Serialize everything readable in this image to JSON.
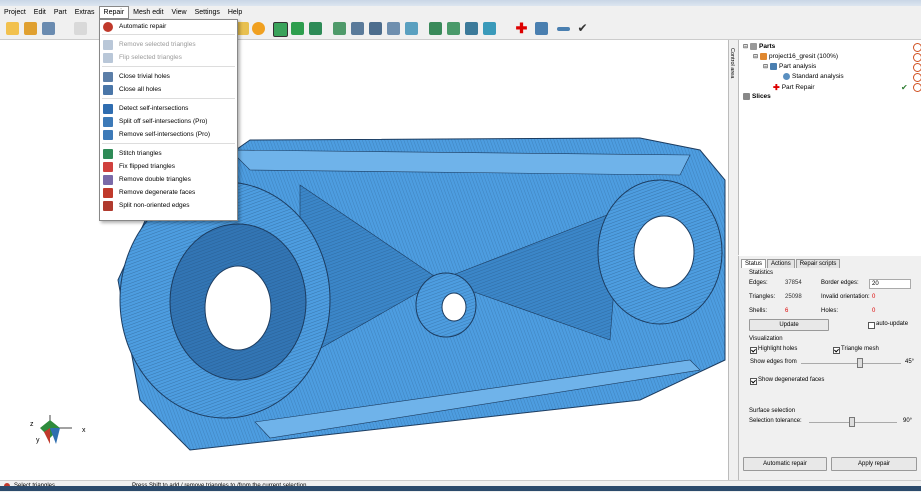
{
  "menu": [
    "Project",
    "Edit",
    "Part",
    "Extras",
    "Repair",
    "Mesh edit",
    "View",
    "Settings",
    "Help"
  ],
  "repair_menu": [
    {
      "label": "Automatic repair",
      "disabled": false,
      "icon": "auto-repair-icon",
      "color": "#c0392b"
    },
    {
      "label": "Remove selected triangles",
      "disabled": true,
      "icon": "remove-triangles-icon",
      "color": "#b9c7d8"
    },
    {
      "label": "Flip selected triangles",
      "disabled": true,
      "icon": "flip-triangles-icon",
      "color": "#b9c7d8"
    },
    {
      "label": "Close trivial holes",
      "disabled": false,
      "icon": "close-trivial-holes-icon",
      "color": "#5b7ea8"
    },
    {
      "label": "Close all holes",
      "disabled": false,
      "icon": "close-all-holes-icon",
      "color": "#4a76a8"
    },
    {
      "label": "Detect self-intersections",
      "disabled": false,
      "icon": "detect-intersections-icon",
      "color": "#2f6db0"
    },
    {
      "label": "Split off self-intersections (Pro)",
      "disabled": false,
      "icon": "split-intersections-icon",
      "color": "#3d7ab8"
    },
    {
      "label": "Remove self-intersections (Pro)",
      "disabled": false,
      "icon": "remove-intersections-icon",
      "color": "#3d7ab8"
    },
    {
      "label": "Stitch triangles",
      "disabled": false,
      "icon": "stitch-icon",
      "color": "#2e8b57"
    },
    {
      "label": "Fix flipped triangles",
      "disabled": false,
      "icon": "fix-flipped-icon",
      "color": "#d0413e"
    },
    {
      "label": "Remove double triangles",
      "disabled": false,
      "icon": "remove-double-icon",
      "color": "#7a6aa8"
    },
    {
      "label": "Remove degenerate faces",
      "disabled": false,
      "icon": "remove-degenerate-icon",
      "color": "#c0392b"
    },
    {
      "label": "Split non-oriented edges",
      "disabled": false,
      "icon": "split-edges-icon",
      "color": "#b03a2e"
    }
  ],
  "side_strip_label": "Control area",
  "tree": {
    "parts_label": "Parts",
    "project_label": "project16_gresit (100%)",
    "analysis_label": "Part analysis",
    "standard_label": "Standard analysis",
    "repair_label": "Part Repair",
    "slices_label": "Slices"
  },
  "tabs": [
    "Status",
    "Actions",
    "Repair scripts"
  ],
  "statistics": {
    "heading": "Statistics",
    "edges_label": "Edges:",
    "edges_value": "37854",
    "border_label": "Border edges:",
    "border_value": "20",
    "triangles_label": "Triangles:",
    "triangles_value": "25098",
    "invalid_label": "Invalid orientation:",
    "invalid_value": "0",
    "shells_label": "Shells:",
    "shells_value": "6",
    "holes_label": "Holes:",
    "holes_value": "0",
    "update_label": "Update",
    "autoupdate_label": "auto-update"
  },
  "visualization": {
    "heading": "Visualization",
    "highlight_label": "Highlight holes",
    "mesh_label": "Triangle mesh",
    "show_edges_label": "Show edges from",
    "angle": "45°",
    "degenerated_label": "Show degenerated faces"
  },
  "surface": {
    "heading": "Surface selection",
    "tolerance_label": "Selection tolerance:",
    "tolerance_value": "90°"
  },
  "buttons": {
    "automatic": "Automatic repair",
    "apply": "Apply repair"
  },
  "axes": {
    "z": "z",
    "x": "x",
    "y": "y"
  },
  "status_bar": {
    "left": "Select triangles",
    "hint": "Press Shift to add / remove triangles to /from the current selection"
  },
  "colors": {
    "mesh": "#4d9de0",
    "mesh_dark": "#2f6fa8",
    "accent": "#2e7d32"
  }
}
